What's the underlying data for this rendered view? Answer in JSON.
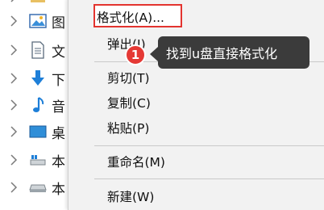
{
  "nav": {
    "items": [
      {
        "label": "图",
        "icon": "picture-icon"
      },
      {
        "label": "文",
        "icon": "document-icon"
      },
      {
        "label": "下",
        "icon": "download-arrow-icon"
      },
      {
        "label": "音",
        "icon": "music-note-icon"
      },
      {
        "label": "桌",
        "icon": "desktop-icon"
      },
      {
        "label": "本",
        "icon": "local-disk-icon"
      },
      {
        "label": "本",
        "icon": "drive-icon"
      }
    ]
  },
  "menu": {
    "format": "格式化(A)...",
    "eject": "弹出(J)",
    "cut": "剪切(T)",
    "copy": "复制(C)",
    "paste": "粘贴(P)",
    "rename": "重命名(M)",
    "new": "新建(W)"
  },
  "annotation": {
    "step": "1",
    "tooltip": "找到u盘直接格式化"
  },
  "colors": {
    "highlight_border": "#e3342f",
    "badge": "#e53935",
    "tooltip_bg": "#3b3b3b"
  }
}
